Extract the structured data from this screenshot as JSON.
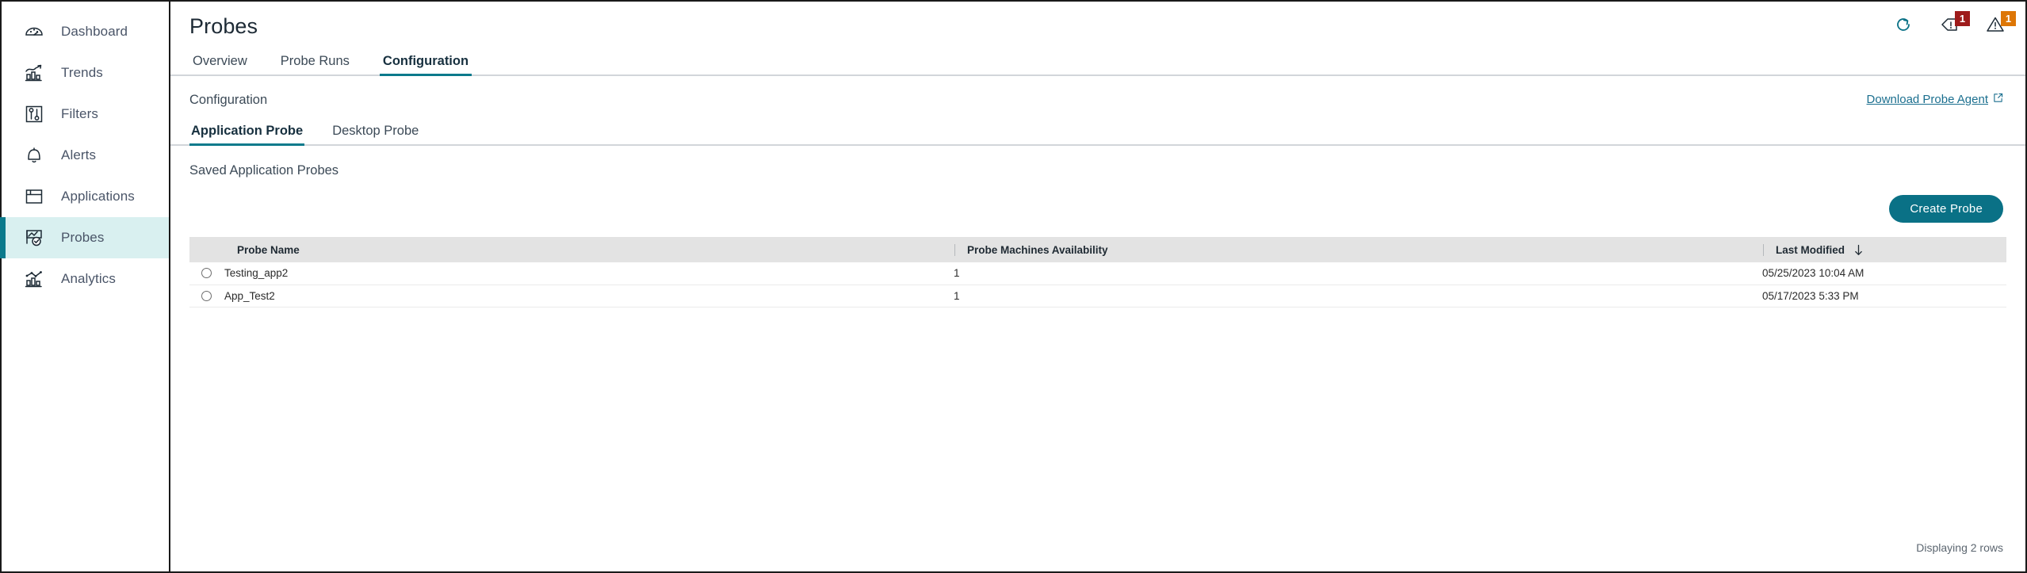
{
  "sidebar": {
    "items": [
      {
        "label": "Dashboard",
        "icon": "gauge-icon",
        "active": false
      },
      {
        "label": "Trends",
        "icon": "trend-chart-icon",
        "active": false
      },
      {
        "label": "Filters",
        "icon": "filters-icon",
        "active": false
      },
      {
        "label": "Alerts",
        "icon": "bell-icon",
        "active": false
      },
      {
        "label": "Applications",
        "icon": "window-icon",
        "active": false
      },
      {
        "label": "Probes",
        "icon": "probe-icon",
        "active": true
      },
      {
        "label": "Analytics",
        "icon": "analytics-icon",
        "active": false
      }
    ]
  },
  "header": {
    "title": "Probes",
    "actions": [
      {
        "name": "refresh-icon",
        "badge": null
      },
      {
        "name": "alert-flag-icon",
        "badge": "1",
        "badge_color": "#9e1b1b"
      },
      {
        "name": "warning-triangle-icon",
        "badge": "1",
        "badge_color": "#dd7606"
      }
    ]
  },
  "tabs": [
    {
      "label": "Overview",
      "active": false
    },
    {
      "label": "Probe Runs",
      "active": false
    },
    {
      "label": "Configuration",
      "active": true
    }
  ],
  "section": {
    "title": "Configuration",
    "download_link": "Download Probe Agent",
    "download_icon": "external-link-icon"
  },
  "subtabs": [
    {
      "label": "Application Probe",
      "active": true
    },
    {
      "label": "Desktop Probe",
      "active": false
    }
  ],
  "saved_title": "Saved Application Probes",
  "create_button": "Create Probe",
  "table": {
    "columns": [
      {
        "key": "select",
        "label": ""
      },
      {
        "key": "name",
        "label": "Probe Name"
      },
      {
        "key": "avail",
        "label": "Probe Machines Availability"
      },
      {
        "key": "modified",
        "label": "Last Modified",
        "sort": "desc",
        "sort_icon": "arrow-down-icon"
      }
    ],
    "rows": [
      {
        "name": "Testing_app2",
        "avail": "1",
        "modified": "05/25/2023 10:04 AM",
        "selected": false
      },
      {
        "name": "App_Test2",
        "avail": "1",
        "modified": "05/17/2023 5:33 PM",
        "selected": false
      }
    ],
    "footer": "Displaying 2 rows"
  },
  "colors": {
    "accent": "#0b7a8c",
    "accent_button": "#0a7186",
    "active_nav_bg": "#d9f0f0",
    "link": "#1b6f8f",
    "badge_red": "#9e1b1b",
    "badge_orange": "#dd7606",
    "header_row": "#e3e3e3"
  }
}
